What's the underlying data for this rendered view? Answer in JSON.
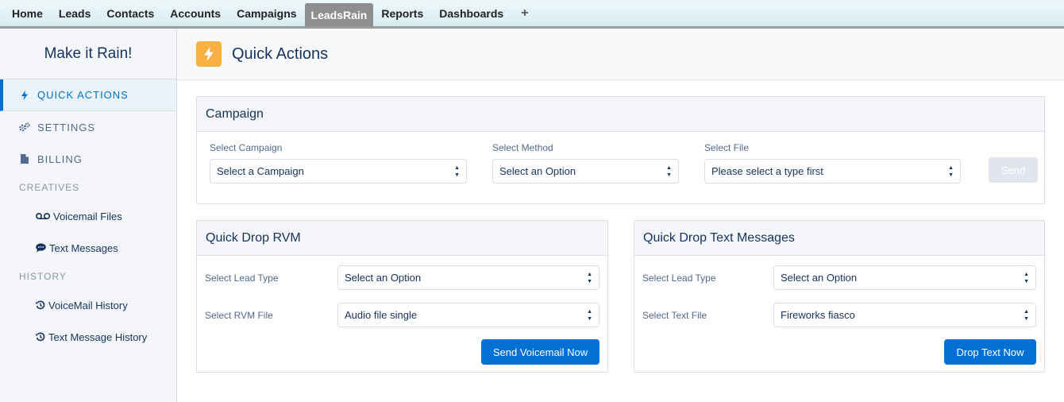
{
  "topbar": {
    "tabs": [
      "Home",
      "Leads",
      "Contacts",
      "Accounts",
      "Campaigns",
      "LeadsRain",
      "Reports",
      "Dashboards"
    ],
    "active_tab": "LeadsRain",
    "add_tab_label": "+"
  },
  "sidebar": {
    "brand": "Make it Rain!",
    "nav": [
      {
        "label": "QUICK ACTIONS",
        "icon": "lightning-icon",
        "active": true
      },
      {
        "label": "SETTINGS",
        "icon": "gears-icon"
      },
      {
        "label": "BILLING",
        "icon": "document-icon"
      }
    ],
    "creatives_label": "CREATIVES",
    "creatives": [
      {
        "label": "Voicemail Files",
        "icon": "voicemail-icon"
      },
      {
        "label": "Text Messages",
        "icon": "chat-bubble-icon"
      }
    ],
    "history_label": "HISTORY",
    "history": [
      {
        "label": "VoiceMail History",
        "icon": "history-icon"
      },
      {
        "label": "Text Message History",
        "icon": "history-icon"
      }
    ]
  },
  "header": {
    "title": "Quick Actions",
    "icon": "lightning-icon",
    "icon_color": "#f8b140"
  },
  "campaign_card": {
    "title": "Campaign",
    "campaign_label": "Select Campaign",
    "campaign_value": "Select a Campaign",
    "method_label": "Select Method",
    "method_value": "Select an Option",
    "file_label": "Select File",
    "file_value": "Please select a type first",
    "send_label": "Send"
  },
  "rvm_card": {
    "title": "Quick Drop RVM",
    "lead_type_label": "Select Lead Type",
    "lead_type_value": "Select an Option",
    "file_label": "Select RVM File",
    "file_value": "Audio file single",
    "button_label": "Send Voicemail Now"
  },
  "text_card": {
    "title": "Quick Drop Text Messages",
    "lead_type_label": "Select Lead Type",
    "lead_type_value": "Select an Option",
    "file_label": "Select Text File",
    "file_value": "Fireworks fiasco",
    "button_label": "Drop Text Now"
  },
  "colors": {
    "accent": "#0070d2",
    "header_icon": "#f8b140",
    "text": "#16325c",
    "disabled_button": "#e0e5ee"
  }
}
